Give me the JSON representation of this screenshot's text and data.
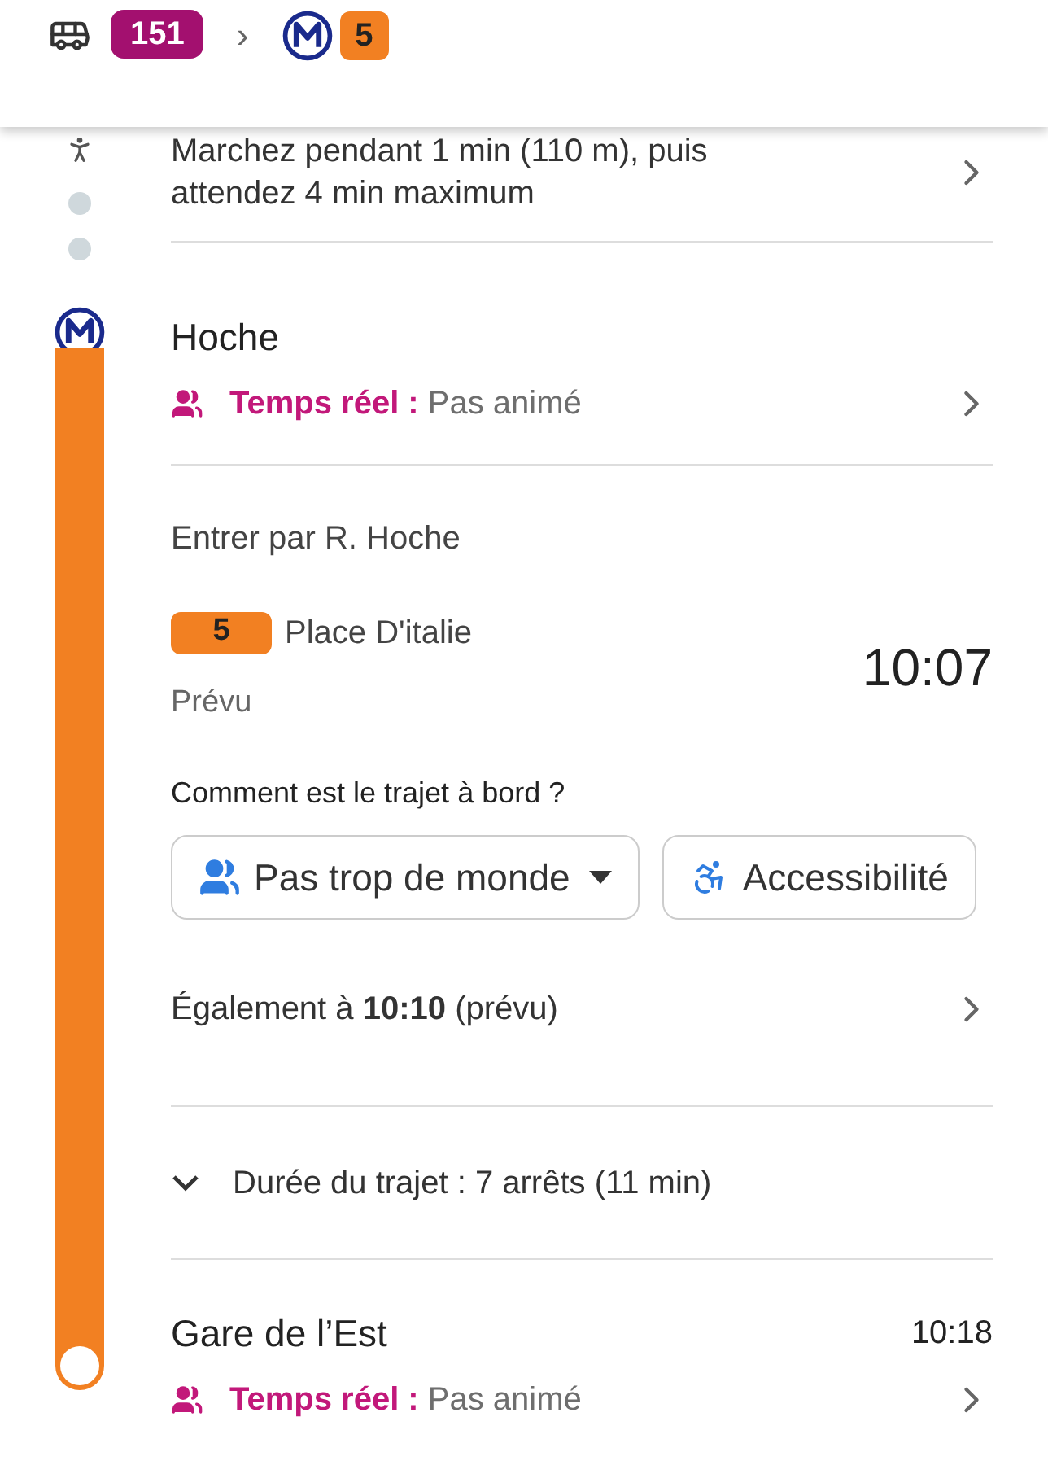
{
  "header": {
    "route": [
      {
        "kind": "bus",
        "label": "151",
        "color": "#a3106f"
      },
      {
        "kind": "separator",
        "label": "›"
      },
      {
        "kind": "metro",
        "label": "5",
        "color": "#f28022"
      }
    ]
  },
  "walk": {
    "text": "Marchez pendant 1 min (110 m), puis attendez 4 min maximum"
  },
  "metro": {
    "line": "5",
    "color": "#f28022",
    "start": {
      "name": "Hoche",
      "realtime_label": "Temps réel :",
      "realtime_value": "Pas animé"
    },
    "entry": "Entrer par R. Hoche",
    "direction": "Place D'italie",
    "status": "Prévu",
    "departure": "10:07",
    "question": "Comment est le trajet à bord ?",
    "chips": [
      {
        "kind": "crowd",
        "label": "Pas trop de monde",
        "dropdown": true
      },
      {
        "kind": "accessibility",
        "label": "Accessibilité",
        "dropdown": false
      }
    ],
    "also": "Également à **10:10** (prévu)",
    "duration": {
      "text": "Durée du trajet : 7 arrêts (11 min)",
      "expanded": false
    },
    "end": {
      "name": "Gare de l’Est",
      "time": "10:18",
      "realtime_label": "Temps réel :",
      "realtime_value": "Pas animé"
    }
  }
}
